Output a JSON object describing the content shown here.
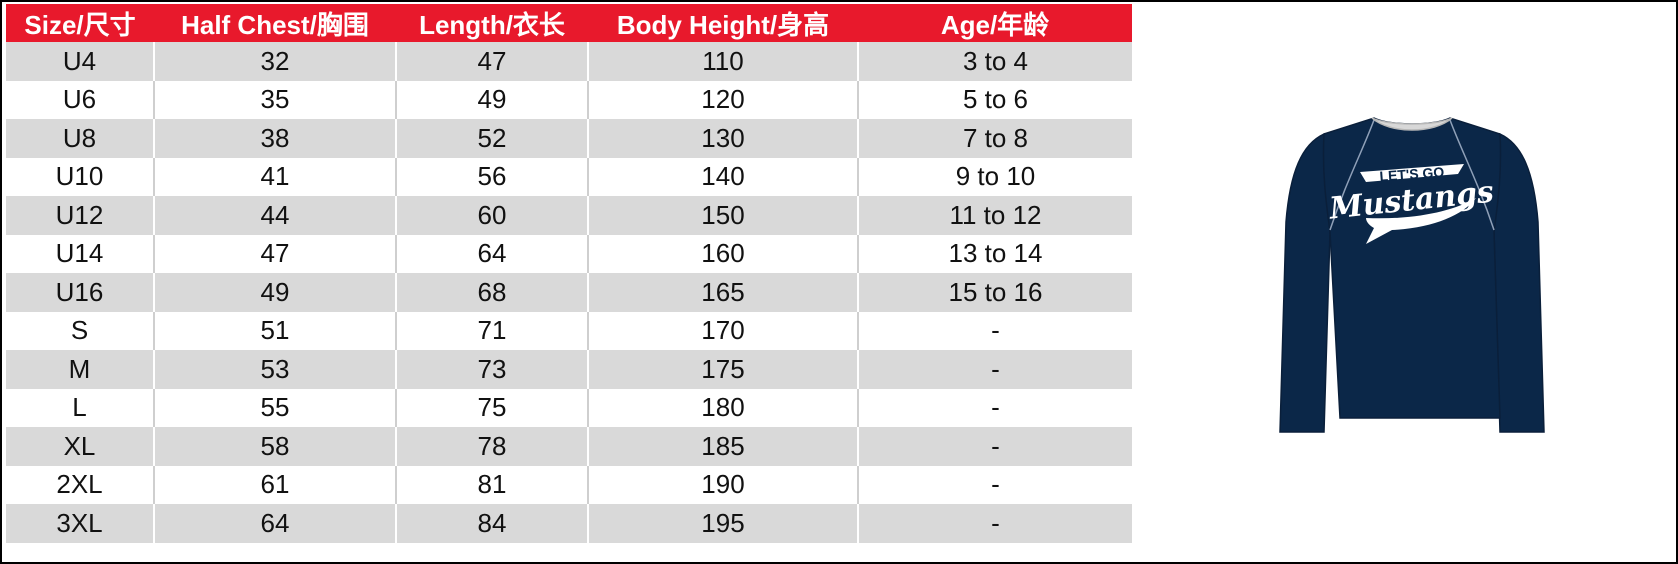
{
  "table": {
    "headers": [
      "Size/尺寸",
      "Half Chest/胸围",
      "Length/衣长",
      "Body Height/身高",
      "Age/年龄"
    ],
    "rows": [
      [
        "U4",
        "32",
        "47",
        "110",
        "3 to 4"
      ],
      [
        "U6",
        "35",
        "49",
        "120",
        "5 to 6"
      ],
      [
        "U8",
        "38",
        "52",
        "130",
        "7 to 8"
      ],
      [
        "U10",
        "41",
        "56",
        "140",
        "9 to 10"
      ],
      [
        "U12",
        "44",
        "60",
        "150",
        "11 to 12"
      ],
      [
        "U14",
        "47",
        "64",
        "160",
        "13 to 14"
      ],
      [
        "U16",
        "49",
        "68",
        "165",
        "15 to 16"
      ],
      [
        "S",
        "51",
        "71",
        "170",
        "-"
      ],
      [
        "M",
        "53",
        "73",
        "175",
        "-"
      ],
      [
        "L",
        "55",
        "75",
        "180",
        "-"
      ],
      [
        "XL",
        "58",
        "78",
        "185",
        "-"
      ],
      [
        "2XL",
        "61",
        "81",
        "190",
        "-"
      ],
      [
        "3XL",
        "64",
        "84",
        "195",
        "-"
      ]
    ]
  },
  "shirt": {
    "icon": "long-sleeve-shirt-icon",
    "color": "#0b2748",
    "graphic_line1": "LET'S GO",
    "graphic_line2": "Mustangs"
  },
  "colors": {
    "header_bg": "#e8192c",
    "row_alt_bg": "#d9d9d9"
  }
}
